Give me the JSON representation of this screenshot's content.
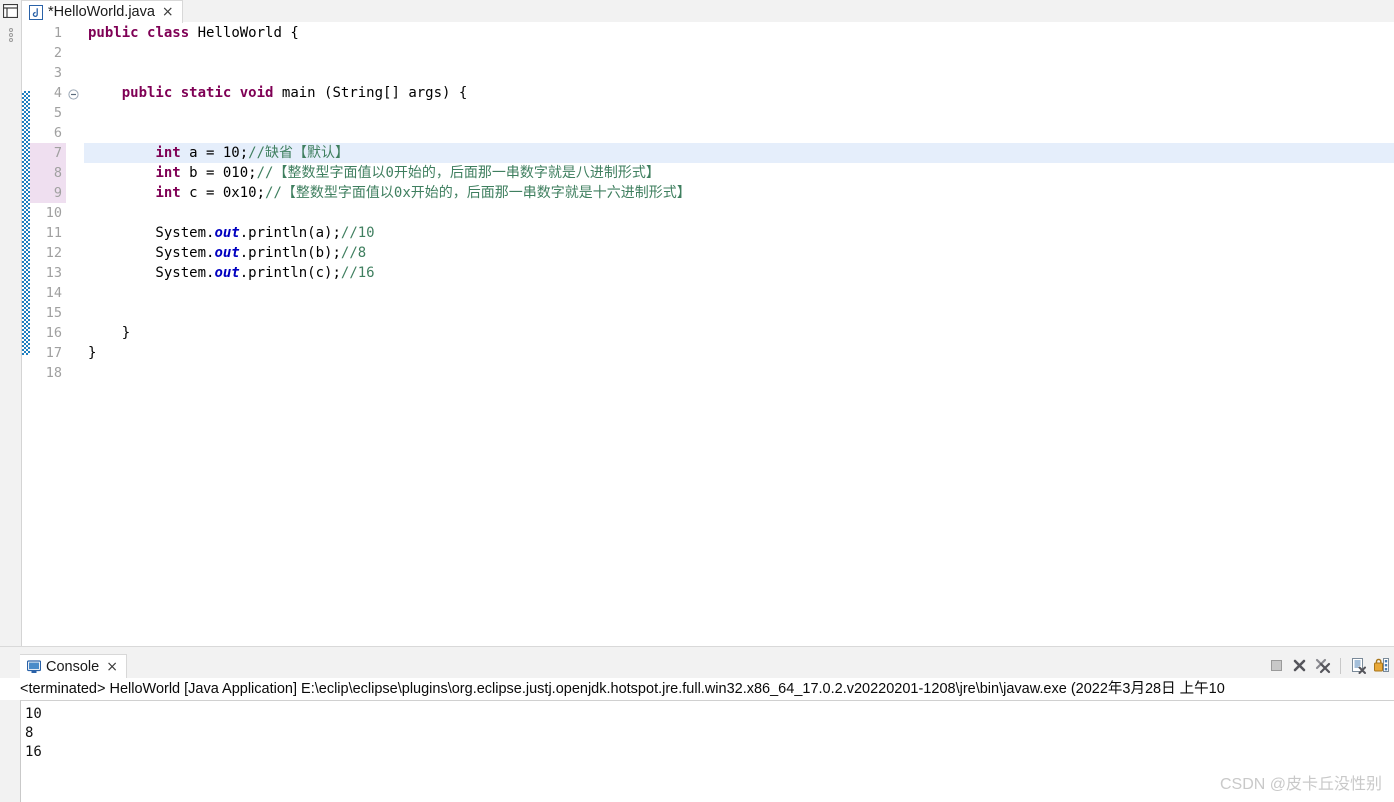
{
  "window": {
    "rail": {
      "restore_icon": "restore-view-icon",
      "drag_handle": "drag-handle-icon"
    }
  },
  "editor": {
    "tab": {
      "icon": "java-file-icon",
      "label": "*HelloWorld.java",
      "close": "×",
      "dirty": true
    },
    "current_line": 7,
    "changed_lines": [
      7,
      8,
      9
    ],
    "change_bar_from": 4,
    "change_bar_to": 16,
    "folding_marker_line": 4,
    "hscroll_left_arrow": "‹",
    "line_numbers": [
      "1",
      "2",
      "3",
      "4",
      "5",
      "6",
      "7",
      "8",
      "9",
      "10",
      "11",
      "12",
      "13",
      "14",
      "15",
      "16",
      "17",
      "18"
    ],
    "lines": [
      {
        "n": 1,
        "tokens": [
          {
            "t": "public",
            "c": "kw"
          },
          {
            "t": " ",
            "c": "plain"
          },
          {
            "t": "class",
            "c": "kw"
          },
          {
            "t": " HelloWorld {",
            "c": "plain"
          }
        ]
      },
      {
        "n": 2,
        "tokens": []
      },
      {
        "n": 3,
        "tokens": []
      },
      {
        "n": 4,
        "tokens": [
          {
            "t": "    ",
            "c": "plain"
          },
          {
            "t": "public",
            "c": "kw"
          },
          {
            "t": " ",
            "c": "plain"
          },
          {
            "t": "static",
            "c": "kw"
          },
          {
            "t": " ",
            "c": "plain"
          },
          {
            "t": "void",
            "c": "kw"
          },
          {
            "t": " main (String[] args) {",
            "c": "plain"
          }
        ]
      },
      {
        "n": 5,
        "tokens": []
      },
      {
        "n": 6,
        "tokens": []
      },
      {
        "n": 7,
        "tokens": [
          {
            "t": "        ",
            "c": "plain"
          },
          {
            "t": "int",
            "c": "kw"
          },
          {
            "t": " a = 10;",
            "c": "plain"
          },
          {
            "t": "//缺省【默认】",
            "c": "cmt"
          }
        ]
      },
      {
        "n": 8,
        "tokens": [
          {
            "t": "        ",
            "c": "plain"
          },
          {
            "t": "int",
            "c": "kw"
          },
          {
            "t": " b = 010;",
            "c": "plain"
          },
          {
            "t": "//【整数型字面值以0开始的，后面那一串数字就是八进制形式】",
            "c": "cmt"
          }
        ]
      },
      {
        "n": 9,
        "tokens": [
          {
            "t": "        ",
            "c": "plain"
          },
          {
            "t": "int",
            "c": "kw"
          },
          {
            "t": " c = 0x10;",
            "c": "plain"
          },
          {
            "t": "//【整数型字面值以0x开始的，后面那一串数字就是十六进制形式】",
            "c": "cmt"
          }
        ]
      },
      {
        "n": 10,
        "tokens": []
      },
      {
        "n": 11,
        "tokens": [
          {
            "t": "        System.",
            "c": "plain"
          },
          {
            "t": "out",
            "c": "fld"
          },
          {
            "t": ".println(a);",
            "c": "plain"
          },
          {
            "t": "//10",
            "c": "cmt"
          }
        ]
      },
      {
        "n": 12,
        "tokens": [
          {
            "t": "        System.",
            "c": "plain"
          },
          {
            "t": "out",
            "c": "fld"
          },
          {
            "t": ".println(b);",
            "c": "plain"
          },
          {
            "t": "//8",
            "c": "cmt"
          }
        ]
      },
      {
        "n": 13,
        "tokens": [
          {
            "t": "        System.",
            "c": "plain"
          },
          {
            "t": "out",
            "c": "fld"
          },
          {
            "t": ".println(c);",
            "c": "plain"
          },
          {
            "t": "//16",
            "c": "cmt"
          }
        ]
      },
      {
        "n": 14,
        "tokens": []
      },
      {
        "n": 15,
        "tokens": []
      },
      {
        "n": 16,
        "tokens": [
          {
            "t": "    }",
            "c": "plain"
          }
        ]
      },
      {
        "n": 17,
        "tokens": [
          {
            "t": "}",
            "c": "plain"
          }
        ]
      },
      {
        "n": 18,
        "tokens": []
      }
    ]
  },
  "console": {
    "tab": {
      "icon": "console-icon",
      "label": "Console",
      "close": "×"
    },
    "toolbar": [
      {
        "name": "stop-button",
        "icon": "stop-square-icon"
      },
      {
        "name": "terminate-button",
        "icon": "terminate-x-icon"
      },
      {
        "name": "remove-all-terminated-button",
        "icon": "remove-all-terminated-icon"
      },
      {
        "name": "clear-console-button",
        "icon": "clear-console-icon"
      },
      {
        "name": "pin-console-button",
        "icon": "lock-pin-icon"
      }
    ],
    "status_line": "<terminated> HelloWorld [Java Application] E:\\eclip\\eclipse\\plugins\\org.eclipse.justj.openjdk.hotspot.jre.full.win32.x86_64_17.0.2.v20220201-1208\\jre\\bin\\javaw.exe  (2022年3月28日 上午10",
    "output": [
      "10",
      "8",
      "16"
    ]
  },
  "watermark": {
    "text": "CSDN @皮卡丘没性别"
  },
  "colors": {
    "keyword": "#7f0055",
    "comment": "#3f7f5f",
    "field": "#0000c0",
    "current_line_bg": "#e5eefb",
    "changed_line_bg": "#efdff0",
    "change_bar": "#1f80c0",
    "chrome_bg": "#f2f2f2"
  }
}
